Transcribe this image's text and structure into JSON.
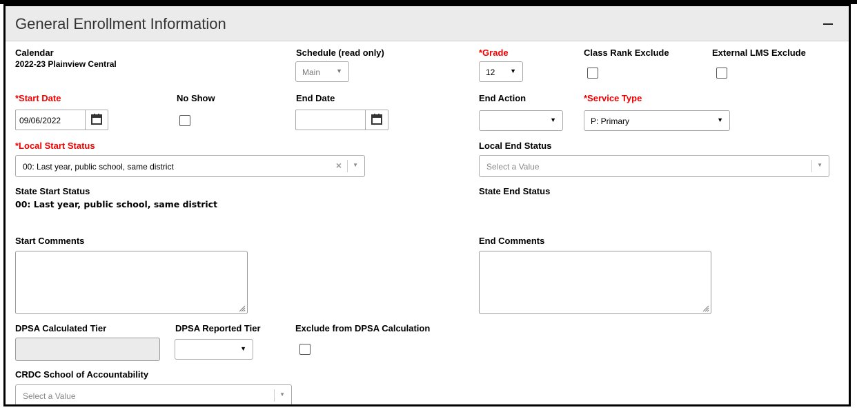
{
  "panel": {
    "title": "General Enrollment Information"
  },
  "calendar": {
    "label": "Calendar",
    "value": "2022-23 Plainview Central"
  },
  "schedule": {
    "label": "Schedule (read only)",
    "value": "Main"
  },
  "grade": {
    "label": "*Grade",
    "value": "12"
  },
  "class_rank_exclude": {
    "label": "Class Rank Exclude"
  },
  "external_lms_exclude": {
    "label": "External LMS Exclude"
  },
  "start_date": {
    "label": "*Start Date",
    "value": "09/06/2022"
  },
  "no_show": {
    "label": "No Show"
  },
  "end_date": {
    "label": "End Date",
    "value": ""
  },
  "end_action": {
    "label": "End Action",
    "value": ""
  },
  "service_type": {
    "label": "*Service Type",
    "value": "P: Primary"
  },
  "local_start_status": {
    "label": "*Local Start Status",
    "value": "00: Last year, public school, same district"
  },
  "local_end_status": {
    "label": "Local End Status",
    "placeholder": "Select a Value"
  },
  "state_start_status": {
    "label": "State Start Status",
    "value": "00: Last year, public school, same district"
  },
  "state_end_status": {
    "label": "State End Status"
  },
  "start_comments": {
    "label": "Start Comments",
    "value": ""
  },
  "end_comments": {
    "label": "End Comments",
    "value": ""
  },
  "dpsa_calculated_tier": {
    "label": "DPSA Calculated Tier",
    "value": ""
  },
  "dpsa_reported_tier": {
    "label": "DPSA Reported Tier",
    "value": ""
  },
  "exclude_dpsa": {
    "label": "Exclude from DPSA Calculation"
  },
  "crdc_school": {
    "label": "CRDC School of Accountability",
    "placeholder": "Select a Value"
  },
  "icons": {
    "calendar": "calendar-icon",
    "dropdown": "chevron-down-icon",
    "clear": "clear-icon",
    "collapse": "minus-icon",
    "resize": "resize-grip-icon"
  },
  "colors": {
    "required_label": "#ee0000",
    "header_bg": "#ebebeb",
    "frame": "#000000"
  }
}
